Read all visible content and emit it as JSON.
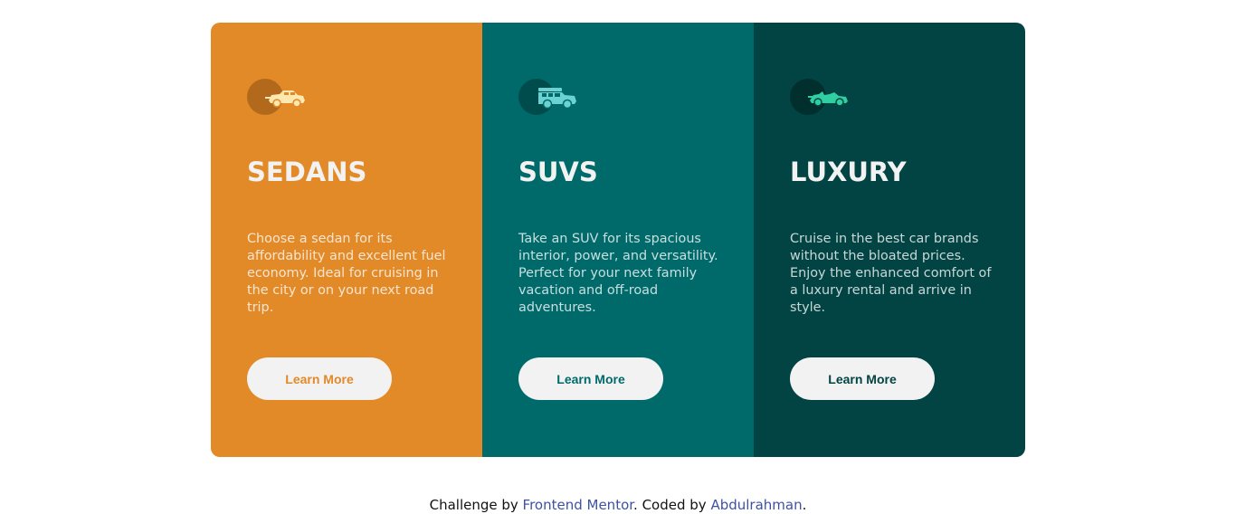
{
  "cards": [
    {
      "id": "sedans",
      "icon": "sedan-car-icon",
      "title": "SEDANS",
      "description": "Choose a sedan for its affordability and excellent fuel economy. Ideal for cruising in the city or on your next road trip.",
      "button_label": "Learn More",
      "color": "#e28928"
    },
    {
      "id": "suvs",
      "icon": "suv-car-icon",
      "title": "SUVS",
      "description": "Take an SUV for its spacious interior, power, and versatility. Perfect for your next family vacation and off-road adventures.",
      "button_label": "Learn More",
      "color": "#006a6b"
    },
    {
      "id": "luxury",
      "icon": "luxury-car-icon",
      "title": "LUXURY",
      "description": "Cruise in the best car brands without the bloated prices. Enjoy the enhanced comfort of a luxury rental and arrive in style.",
      "button_label": "Learn More",
      "color": "#014443"
    }
  ],
  "attribution": {
    "prefix": "Challenge by ",
    "challenge_link": "Frontend Mentor",
    "middle": ". Coded by ",
    "author_link": "Abdulrahman",
    "suffix": ".",
    "link_color": "#3e52a3"
  }
}
